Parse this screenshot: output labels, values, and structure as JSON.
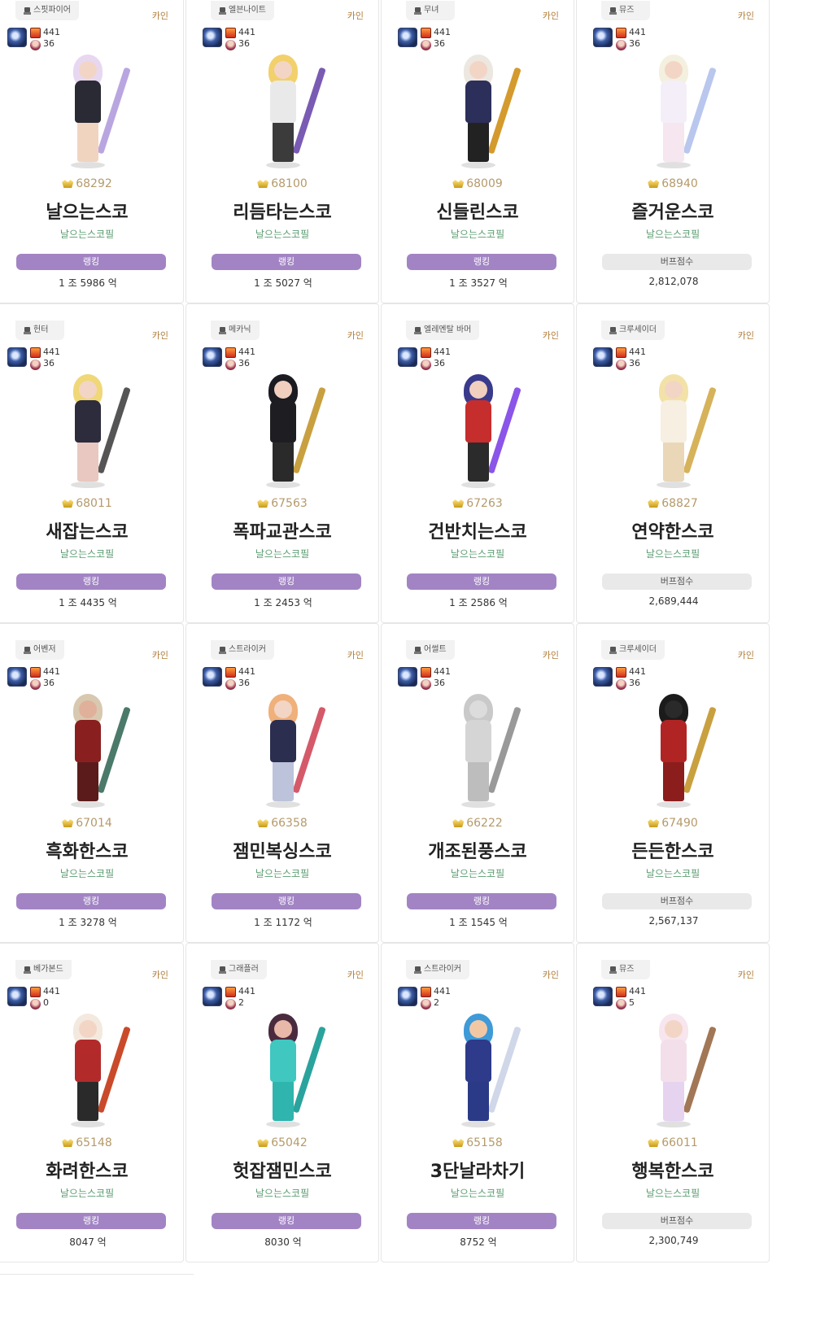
{
  "cards": [
    {
      "job": "스핏파이어",
      "server": "카인",
      "level": "441",
      "sub": "36",
      "fame": "68292",
      "name": "날으는스코",
      "adventure": "날으는스코필",
      "button": "랭킹",
      "value": "1 조 5986 억",
      "buff": false,
      "palette": {
        "hair": "#e8d7f0",
        "body": "#2a2a35",
        "legs": "#f1d4c0",
        "weapon": "#b9a6e0",
        "head": "#f3d5c6"
      }
    },
    {
      "job": "엘븐나이트",
      "server": "카인",
      "level": "441",
      "sub": "36",
      "fame": "68100",
      "name": "리듬타는스코",
      "adventure": "날으는스코필",
      "button": "랭킹",
      "value": "1 조 5027 억",
      "buff": false,
      "palette": {
        "hair": "#f2d06b",
        "body": "#e9e9e9",
        "legs": "#3b3b3b",
        "weapon": "#7a5bb3",
        "head": "#f3d5c6"
      }
    },
    {
      "job": "무녀",
      "server": "카인",
      "level": "441",
      "sub": "36",
      "fame": "68009",
      "name": "신들린스코",
      "adventure": "날으는스코필",
      "button": "랭킹",
      "value": "1 조 3527 억",
      "buff": false,
      "palette": {
        "hair": "#ece7e0",
        "body": "#2b2f5a",
        "legs": "#222",
        "weapon": "#d59a2d",
        "head": "#f3d5c6"
      }
    },
    {
      "job": "뮤즈",
      "server": "카인",
      "level": "441",
      "sub": "36",
      "fame": "68940",
      "name": "즐거운스코",
      "adventure": "날으는스코필",
      "button": "버프점수",
      "value": "2,812,078",
      "buff": true,
      "palette": {
        "hair": "#f4f0df",
        "body": "#f3eef8",
        "legs": "#f6e6ef",
        "weapon": "#b9c7ee",
        "head": "#f3d5c6"
      }
    },
    {
      "job": "헌터",
      "server": "카인",
      "level": "441",
      "sub": "36",
      "fame": "68011",
      "name": "새잡는스코",
      "adventure": "날으는스코필",
      "button": "랭킹",
      "value": "1 조 4435 억",
      "buff": false,
      "palette": {
        "hair": "#f0d777",
        "body": "#2c2c3c",
        "legs": "#e8c8c0",
        "weapon": "#555",
        "head": "#f3d5c6"
      }
    },
    {
      "job": "메카닉",
      "server": "카인",
      "level": "441",
      "sub": "36",
      "fame": "67563",
      "name": "폭파교관스코",
      "adventure": "날으는스코필",
      "button": "랭킹",
      "value": "1 조 2453 억",
      "buff": false,
      "palette": {
        "hair": "#1b1b22",
        "body": "#1e1e22",
        "legs": "#2a2a2a",
        "weapon": "#c9a040",
        "head": "#f0cfbf"
      }
    },
    {
      "job": "엘레멘탈 바머",
      "server": "카인",
      "level": "441",
      "sub": "36",
      "fame": "67263",
      "name": "건반치는스코",
      "adventure": "날으는스코필",
      "button": "랭킹",
      "value": "1 조 2586 억",
      "buff": false,
      "palette": {
        "hair": "#3a3a8c",
        "body": "#c62d2d",
        "legs": "#2b2b2b",
        "weapon": "#8a55e8",
        "head": "#f0cfbf"
      }
    },
    {
      "job": "크루세이더",
      "server": "카인",
      "level": "441",
      "sub": "36",
      "fame": "68827",
      "name": "연약한스코",
      "adventure": "날으는스코필",
      "button": "버프점수",
      "value": "2,689,444",
      "buff": true,
      "palette": {
        "hair": "#f3e2a8",
        "body": "#f6efe2",
        "legs": "#e9d7b8",
        "weapon": "#d6b25a",
        "head": "#f3d5c6"
      }
    },
    {
      "job": "어벤저",
      "server": "카인",
      "level": "441",
      "sub": "36",
      "fame": "67014",
      "name": "흑화한스코",
      "adventure": "날으는스코필",
      "button": "랭킹",
      "value": "1 조 3278 억",
      "buff": false,
      "palette": {
        "hair": "#d8c8b0",
        "body": "#8a1f1f",
        "legs": "#5b1b1b",
        "weapon": "#4b7a6a",
        "head": "#e0b09a"
      }
    },
    {
      "job": "스트라이커",
      "server": "카인",
      "level": "441",
      "sub": "36",
      "fame": "66358",
      "name": "잼민복싱스코",
      "adventure": "날으는스코필",
      "button": "랭킹",
      "value": "1 조 1172 억",
      "buff": false,
      "palette": {
        "hair": "#f0b07a",
        "body": "#2b2e4f",
        "legs": "#bcc3da",
        "weapon": "#d45a6a",
        "head": "#f3d5c6"
      }
    },
    {
      "job": "어썰트",
      "server": "카인",
      "level": "441",
      "sub": "36",
      "fame": "66222",
      "name": "개조된풍스코",
      "adventure": "날으는스코필",
      "button": "랭킹",
      "value": "1 조 1545 억",
      "buff": false,
      "palette": {
        "hair": "#c9c9c9",
        "body": "#d5d5d5",
        "legs": "#bdbdbd",
        "weapon": "#999",
        "head": "#dcdcdc"
      }
    },
    {
      "job": "크루세이더",
      "server": "카인",
      "level": "441",
      "sub": "36",
      "fame": "67490",
      "name": "든든한스코",
      "adventure": "날으는스코필",
      "button": "버프점수",
      "value": "2,567,137",
      "buff": true,
      "palette": {
        "hair": "#1b1b1b",
        "body": "#b12424",
        "legs": "#8c1d1d",
        "weapon": "#c9a040",
        "head": "#2a2a2a"
      }
    },
    {
      "job": "베가본드",
      "server": "카인",
      "level": "441",
      "sub": "0",
      "fame": "65148",
      "name": "화려한스코",
      "adventure": "날으는스코필",
      "button": "랭킹",
      "value": "8047 억",
      "buff": false,
      "palette": {
        "hair": "#f3e9df",
        "body": "#b32a2a",
        "legs": "#2a2a2a",
        "weapon": "#c94a2a",
        "head": "#f3d5c6"
      }
    },
    {
      "job": "그래플러",
      "server": "카인",
      "level": "441",
      "sub": "2",
      "fame": "65042",
      "name": "헛잡잼민스코",
      "adventure": "날으는스코필",
      "button": "랭킹",
      "value": "8030 억",
      "buff": false,
      "palette": {
        "hair": "#4a2b3e",
        "body": "#3fc7c0",
        "legs": "#2fb4ae",
        "weapon": "#2aa39d",
        "head": "#e8b8a8"
      }
    },
    {
      "job": "스트라이커",
      "server": "카인",
      "level": "441",
      "sub": "2",
      "fame": "65158",
      "name": "3단날라차기",
      "adventure": "날으는스코필",
      "button": "랭킹",
      "value": "8752 억",
      "buff": false,
      "palette": {
        "hair": "#3f9ad8",
        "body": "#2d3b8a",
        "legs": "#2b3a86",
        "weapon": "#cfd7e9",
        "head": "#f2c8a4"
      }
    },
    {
      "job": "뮤즈",
      "server": "카인",
      "level": "441",
      "sub": "5",
      "fame": "66011",
      "name": "행복한스코",
      "adventure": "날으는스코필",
      "button": "버프점수",
      "value": "2,300,749",
      "buff": true,
      "palette": {
        "hair": "#f7e6ee",
        "body": "#f2dfe9",
        "legs": "#e5d3f0",
        "weapon": "#a27755",
        "head": "#f3d5c6"
      }
    }
  ]
}
